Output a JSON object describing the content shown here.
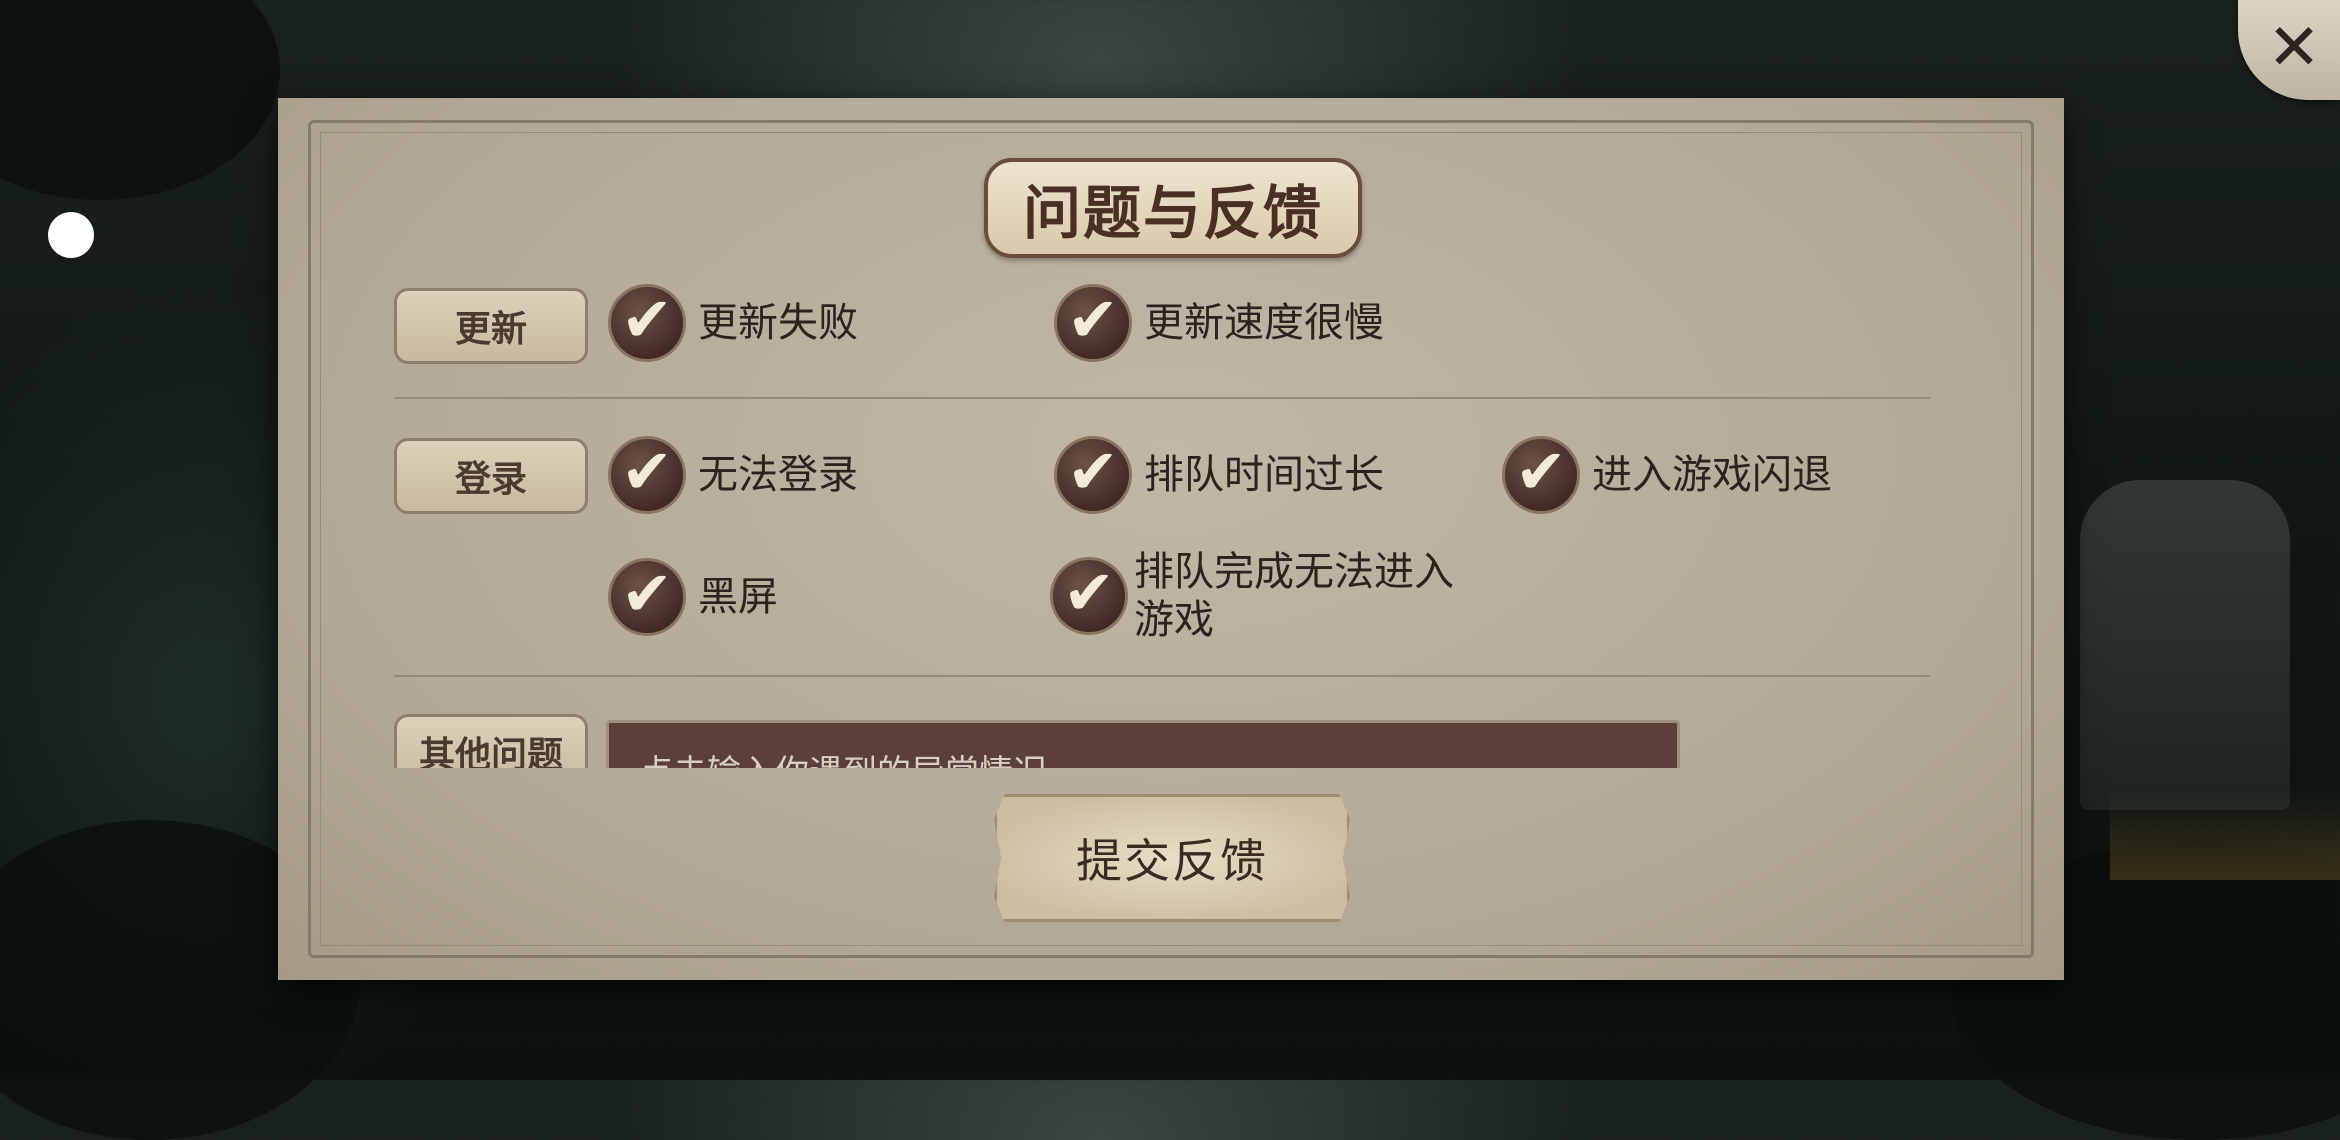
{
  "dialog": {
    "title": "问题与反馈",
    "close_icon": "close-icon",
    "categories": [
      {
        "label": "更新",
        "options": [
          "更新失败",
          "更新速度很慢"
        ]
      },
      {
        "label": "登录",
        "options": [
          "无法登录",
          "排队时间过长",
          "进入游戏闪退",
          "黑屏",
          "排队完成无法进入",
          "游戏"
        ]
      },
      {
        "label": "其他问题",
        "input_placeholder": "点击输入你遇到的异常情况"
      }
    ],
    "submit_label": "提交反馈",
    "checked_states": [
      true,
      true,
      true,
      true,
      true,
      true,
      true
    ]
  },
  "colors": {
    "panel": "#b8af9c",
    "check_bg": "#4e362e",
    "check_mark": "#f3ead8",
    "title_text": "#4a2f25"
  }
}
